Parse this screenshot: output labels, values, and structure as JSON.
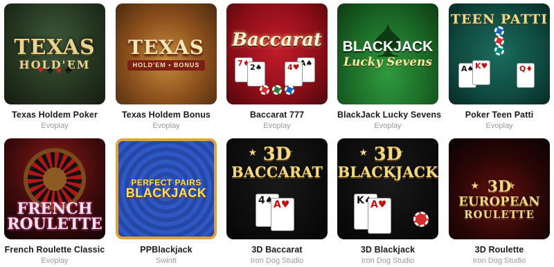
{
  "games": [
    {
      "title": "Texas Holdem Poker",
      "provider": "Evoplay",
      "art": {
        "line1": "TEXAS",
        "line2": "HOLD'EM",
        "suits": "♥ ♠ ♦ ♣",
        "accent": "#e8d490"
      }
    },
    {
      "title": "Texas Holdem Bonus",
      "provider": "Evoplay",
      "art": {
        "line1": "TEXAS",
        "line2": "HOLD'EM • BONUS",
        "accent": "#f6e6b3"
      }
    },
    {
      "title": "Baccarat 777",
      "provider": "Evoplay",
      "art": {
        "line1": "Baccarat",
        "accent": "#c21d2a"
      }
    },
    {
      "title": "BlackJack Lucky Sevens",
      "provider": "Evoplay",
      "art": {
        "line1": "BLACKJACK",
        "line2": "Lucky Sevens",
        "accent": "#2f9a3e"
      }
    },
    {
      "title": "Poker Teen Patti",
      "provider": "Evoplay",
      "art": {
        "line1": "TEEN PATTI",
        "accent": "#f0d889"
      }
    },
    {
      "title": "French Roulette Classic",
      "provider": "Evoplay",
      "art": {
        "line1": "FRENCH",
        "line2": "ROULETTE",
        "accent": "#d43a8a"
      }
    },
    {
      "title": "PPBlackjack",
      "provider": "Swintt",
      "art": {
        "line1": "PERFECT PAIRS",
        "line2": "BLACKJACK",
        "accent": "#ffde5a"
      }
    },
    {
      "title": "3D Baccarat",
      "provider": "Iron Dog Studio",
      "art": {
        "line1": "3D",
        "line2": "BACCARAT",
        "stars": "★ ★",
        "accent": "#f3d884"
      }
    },
    {
      "title": "3D Blackjack",
      "provider": "Iron Dog Studio",
      "art": {
        "line1": "3D",
        "line2": "BLACKJACK",
        "stars": "★ ★",
        "accent": "#f3d884"
      }
    },
    {
      "title": "3D Roulette",
      "provider": "Iron Dog Studio",
      "art": {
        "line1": "3D",
        "line2": "EUROPEAN",
        "line3": "ROULETTE",
        "stars": "★ ★",
        "accent": "#f3d884"
      }
    }
  ],
  "cards": {
    "baccarat": [
      "7♦",
      "2♠",
      "A♠",
      "4♥"
    ],
    "teen_patti": [
      "A♠",
      "K♥",
      "Q♦"
    ],
    "baccarat3d": [
      "4♠",
      "A♥"
    ],
    "blackjack3d": [
      "K♠",
      "A♥"
    ]
  }
}
